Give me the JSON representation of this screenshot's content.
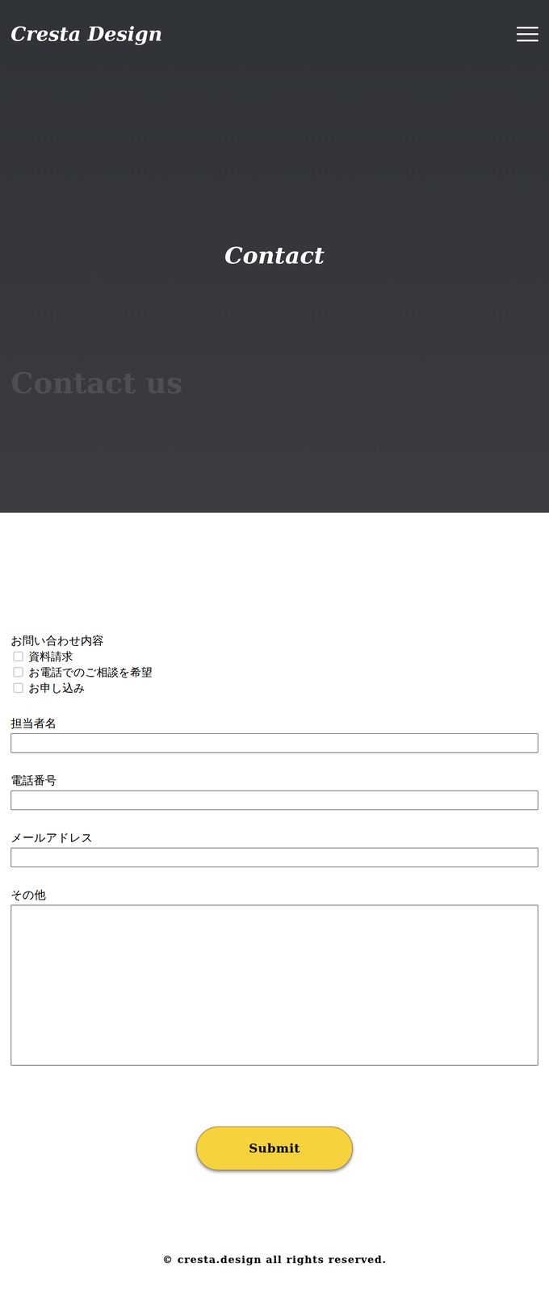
{
  "header": {
    "logo": "Cresta Design"
  },
  "hero": {
    "title": "Contact",
    "watermark": "Contact us"
  },
  "form": {
    "inquiry": {
      "label": "お問い合わせ内容",
      "options": [
        {
          "label": "資料請求",
          "checked": false
        },
        {
          "label": "お電話でのご相談を希望",
          "checked": false
        },
        {
          "label": "お申し込み",
          "checked": false
        }
      ]
    },
    "fields": [
      {
        "label": "担当者名",
        "kind": "input",
        "value": ""
      },
      {
        "label": "電話番号",
        "kind": "input",
        "value": ""
      },
      {
        "label": "メールアドレス",
        "kind": "input",
        "value": ""
      },
      {
        "label": "その他",
        "kind": "textarea",
        "value": ""
      }
    ],
    "submit": "Submit"
  },
  "footer": {
    "copyright": "© cresta.design all rights reserved."
  }
}
